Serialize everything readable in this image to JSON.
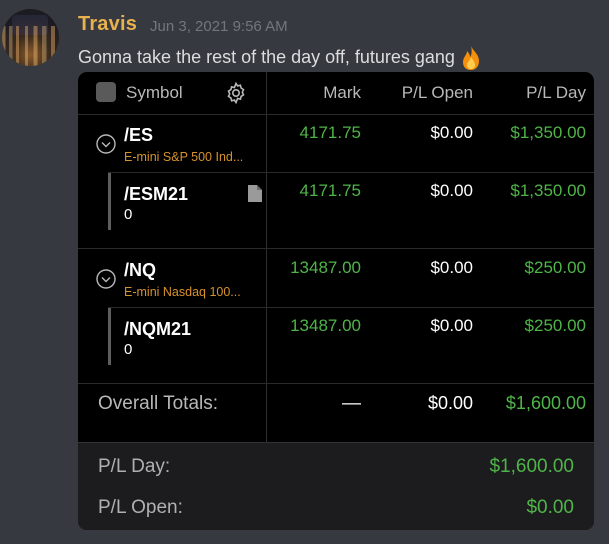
{
  "author": "Travis",
  "timestamp": "Jun 3, 2021 9:56 AM",
  "message": "Gonna take the rest of the day off, futures gang",
  "emoji": "fire-emoji",
  "table": {
    "headers": {
      "symbol": "Symbol",
      "mark": "Mark",
      "pl_open": "P/L Open",
      "pl_day": "P/L Day"
    },
    "groups": [
      {
        "symbol": "/ES",
        "description": "E-mini S&P 500 Ind...",
        "mark": "4171.75",
        "pl_open": "$0.00",
        "pl_day": "$1,350.00",
        "child": {
          "symbol": "/ESM21",
          "qty": "0",
          "mark": "4171.75",
          "pl_open": "$0.00",
          "pl_day": "$1,350.00"
        }
      },
      {
        "symbol": "/NQ",
        "description": "E-mini Nasdaq 100...",
        "mark": "13487.00",
        "pl_open": "$0.00",
        "pl_day": "$250.00",
        "child": {
          "symbol": "/NQM21",
          "qty": "0",
          "mark": "13487.00",
          "pl_open": "$0.00",
          "pl_day": "$250.00"
        }
      }
    ],
    "totals": {
      "label": "Overall Totals:",
      "mark": "—",
      "pl_open": "$0.00",
      "pl_day": "$1,600.00"
    }
  },
  "summary": {
    "pl_day_label": "P/L Day:",
    "pl_day_value": "$1,600.00",
    "pl_open_label": "P/L Open:",
    "pl_open_value": "$0.00"
  },
  "colors": {
    "author": "#e8b14e",
    "gain": "#4fb548",
    "description": "#d8922b"
  }
}
